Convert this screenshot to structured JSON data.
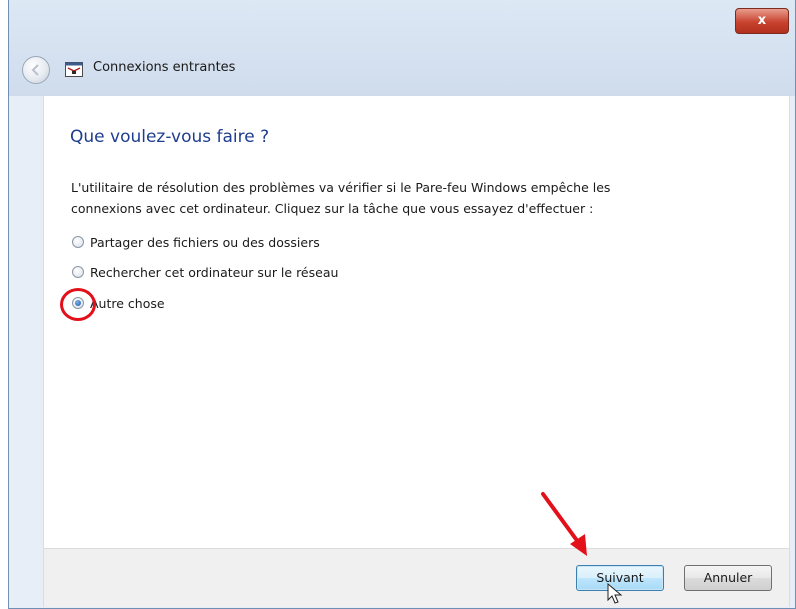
{
  "window": {
    "title": "Connexions entrantes",
    "close_label": "x"
  },
  "page": {
    "heading": "Que voulez-vous faire ?",
    "description_line1": "L'utilitaire de résolution des problèmes va vérifier si le Pare-feu Windows empêche les",
    "description_line2": "connexions avec cet ordinateur. Cliquez sur la tâche que vous essayez d'effectuer :"
  },
  "options": [
    {
      "label": "Partager des fichiers ou des dossiers",
      "checked": false
    },
    {
      "label": "Rechercher cet ordinateur sur le réseau",
      "checked": false
    },
    {
      "label": "Autre chose",
      "checked": true
    }
  ],
  "footer": {
    "next_label": "Suivant",
    "cancel_label": "Annuler"
  },
  "colors": {
    "heading": "#1e3d8f",
    "highlight": "#e3101a",
    "arrow": "#e3101a"
  },
  "icons": {
    "back": "back-arrow-icon",
    "firewall": "firewall-icon",
    "cursor": "mouse-cursor-icon"
  }
}
